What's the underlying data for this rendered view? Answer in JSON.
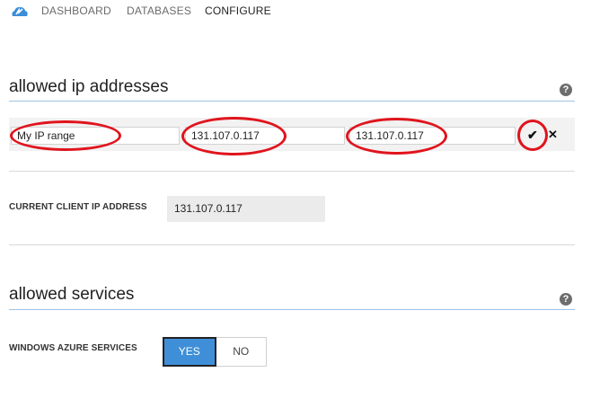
{
  "nav": {
    "items": [
      {
        "label": "DASHBOARD"
      },
      {
        "label": "DATABASES"
      },
      {
        "label": "CONFIGURE"
      }
    ],
    "active": "CONFIGURE"
  },
  "allowed_ip": {
    "title": "allowed ip addresses",
    "help": "?",
    "rule_name": "My IP range",
    "start_ip": "131.107.0.117",
    "end_ip": "131.107.0.117",
    "confirm_icon": "✔",
    "delete_icon": "✕"
  },
  "client_ip": {
    "label": "CURRENT CLIENT IP ADDRESS",
    "value": "131.107.0.117"
  },
  "allowed_services": {
    "title": "allowed services",
    "help": "?",
    "windows_azure_label": "WINDOWS AZURE SERVICES",
    "yes_label": "YES",
    "no_label": "NO",
    "selected": "YES"
  },
  "colors": {
    "accent": "#3f8fd8",
    "rule": "#9ec3e6",
    "highlight_ellipse": "#e0141d"
  }
}
